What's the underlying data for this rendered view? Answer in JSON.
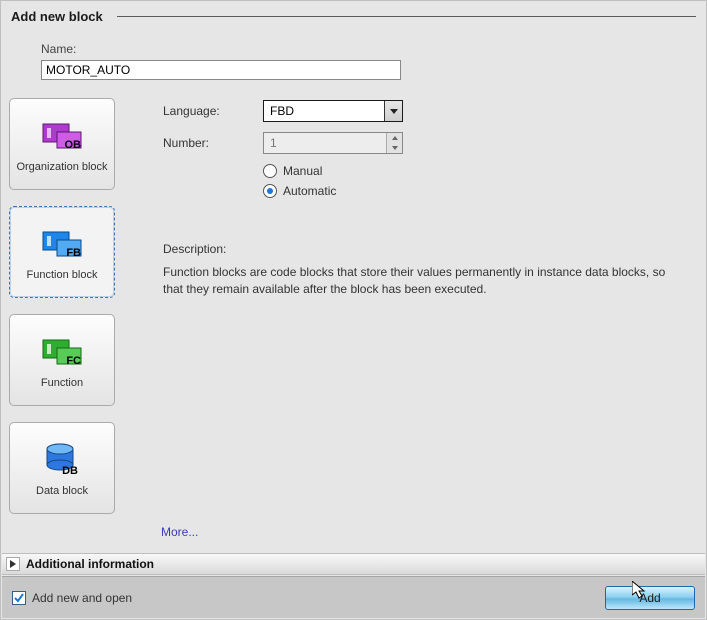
{
  "dialog": {
    "title": "Add new block"
  },
  "name": {
    "label": "Name:",
    "value": "MOTOR_AUTO"
  },
  "blocks": {
    "ob": {
      "label": "Organization block",
      "tag": "OB",
      "color": "#b03ad0",
      "shape": "brick"
    },
    "fb": {
      "label": "Function block",
      "tag": "FB",
      "color": "#1e86e8",
      "shape": "brick"
    },
    "fc": {
      "label": "Function",
      "tag": "FC",
      "color": "#2fad2f",
      "shape": "brick"
    },
    "db": {
      "label": "Data block",
      "tag": "DB",
      "color": "#2c78e0",
      "shape": "cylinder"
    },
    "selected": "fb"
  },
  "fields": {
    "language": {
      "label": "Language:",
      "value": "FBD"
    },
    "number": {
      "label": "Number:",
      "value": "1"
    },
    "mode": {
      "manual": "Manual",
      "automatic": "Automatic",
      "selected": "automatic"
    }
  },
  "description": {
    "label": "Description:",
    "text": "Function blocks are code blocks that store their values permanently in instance data blocks, so that they remain available after the block has been executed."
  },
  "more_link": "More...",
  "expander": {
    "label": "Additional  information"
  },
  "footer": {
    "checkbox_label": "Add new and open",
    "checkbox_checked": true,
    "add_button": "Add"
  }
}
